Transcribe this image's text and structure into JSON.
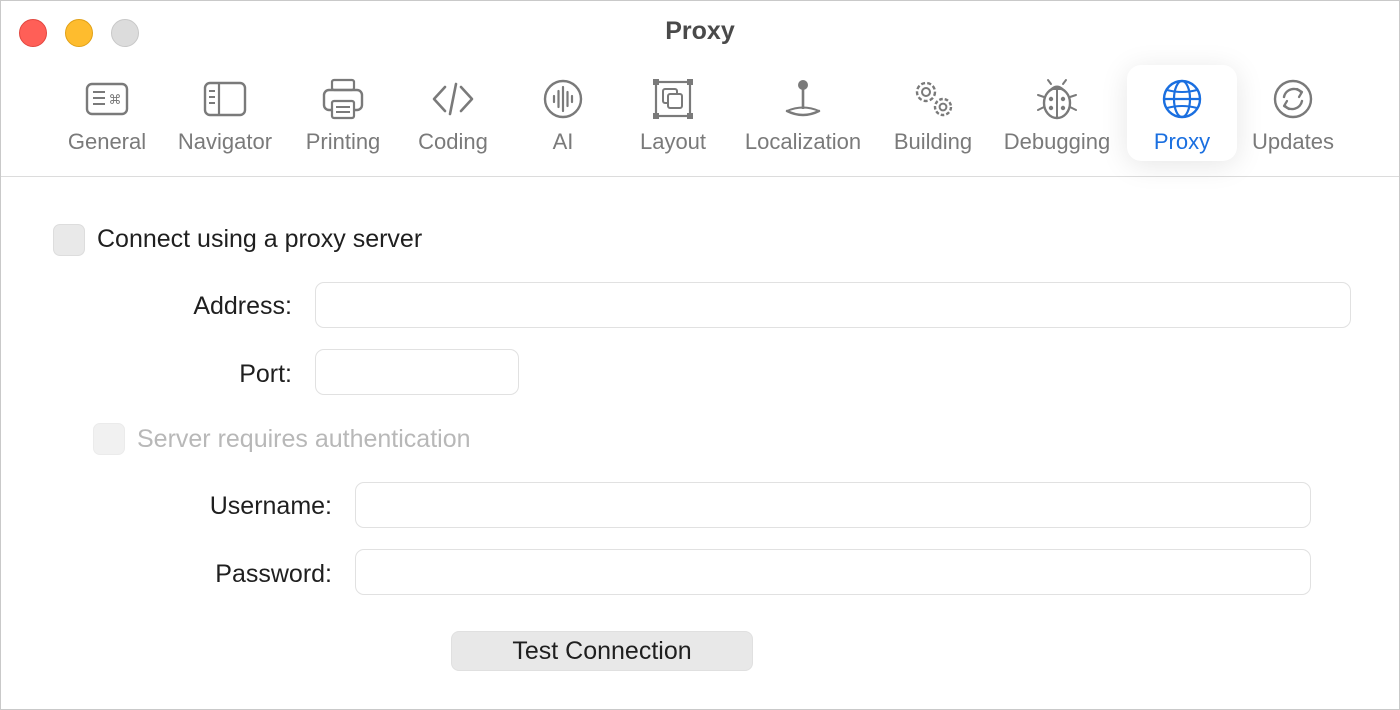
{
  "window": {
    "title": "Proxy"
  },
  "toolbar": {
    "items": [
      {
        "label": "General",
        "icon": "keyboard-icon"
      },
      {
        "label": "Navigator",
        "icon": "sidebar-icon"
      },
      {
        "label": "Printing",
        "icon": "printer-icon"
      },
      {
        "label": "Coding",
        "icon": "code-brackets-icon"
      },
      {
        "label": "AI",
        "icon": "waveform-icon"
      },
      {
        "label": "Layout",
        "icon": "layout-frame-icon"
      },
      {
        "label": "Localization",
        "icon": "joystick-icon"
      },
      {
        "label": "Building",
        "icon": "gears-icon"
      },
      {
        "label": "Debugging",
        "icon": "ladybug-icon"
      },
      {
        "label": "Proxy",
        "icon": "globe-icon"
      },
      {
        "label": "Updates",
        "icon": "refresh-icon"
      }
    ],
    "selected": "Proxy",
    "accent_color": "#1a6fe0"
  },
  "proxy": {
    "use_proxy_label": "Connect using a proxy server",
    "use_proxy_checked": false,
    "address_label": "Address:",
    "address_value": "",
    "port_label": "Port:",
    "port_value": "",
    "auth_label": "Server requires authentication",
    "auth_checked": false,
    "username_label": "Username:",
    "username_value": "",
    "password_label": "Password:",
    "password_value": "",
    "test_button": "Test Connection"
  }
}
